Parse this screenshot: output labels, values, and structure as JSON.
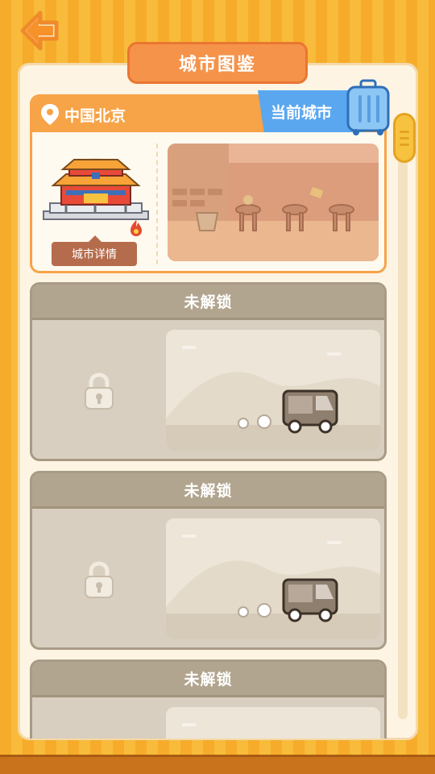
{
  "header": {
    "title": "城市图鉴"
  },
  "current_city": {
    "location": "中国北京",
    "tag": "当前城市",
    "detail_button": "城市详情"
  },
  "locked_cards": [
    {
      "label": "未解锁"
    },
    {
      "label": "未解锁"
    },
    {
      "label": "未解锁"
    }
  ],
  "colors": {
    "accent_orange": "#f7a348",
    "title_orange": "#f5934a",
    "current_blue": "#5aa7f0",
    "locked_gray": "#b2a58f"
  },
  "icons": [
    "back-arrow-icon",
    "location-pin-icon",
    "suitcase-icon",
    "lock-icon",
    "fire-icon"
  ]
}
